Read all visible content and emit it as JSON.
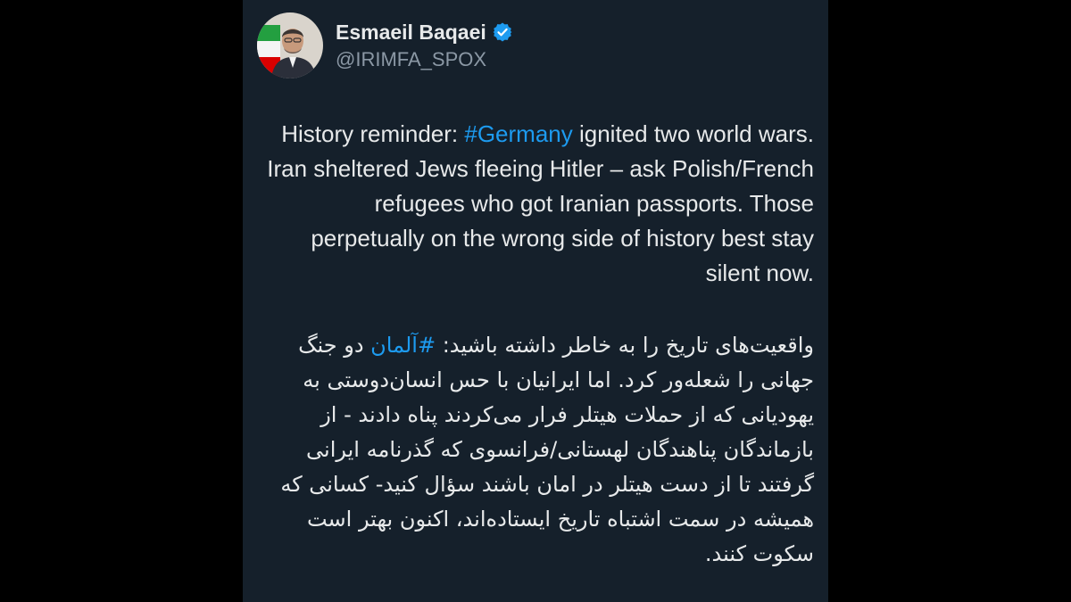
{
  "profile": {
    "display_name": "Esmaeil Baqaei",
    "handle": "@IRIMFA_SPOX",
    "verified_badge": "verified-badge-icon"
  },
  "tweet": {
    "en_pre": "History reminder: ",
    "en_hashtag": "#Germany",
    "en_post": " ignited two world wars. Iran sheltered Jews fleeing Hitler – ask Polish/French refugees who got Iranian passports. Those perpetually on the wrong side of history best stay silent now.",
    "fa_pre": "واقعیت‌های تاریخ را به خاطر داشته باشید: ",
    "fa_hashtag": "#آلمان",
    "fa_post": " دو جنگ جهانی را شعله‌ور کرد. اما ایرانیان با حس انسان‌دوستی به یهودیانی که از حملات هیتلر فرار می‌کردند پناه دادند - از بازماندگان پناهندگان لهستانی/فرانسوی که گذرنامه ایرانی گرفتند تا از دست هیتلر در امان باشند سؤال کنید- کسانی که همیشه در سمت اشتباه تاریخ ایستاده‌اند، اکنون بهتر است سکوت کنند."
  },
  "colors": {
    "background": "#15202b",
    "text": "#e7e9ea",
    "handle": "#8b98a5",
    "hashtag": "#1d9bf0"
  }
}
